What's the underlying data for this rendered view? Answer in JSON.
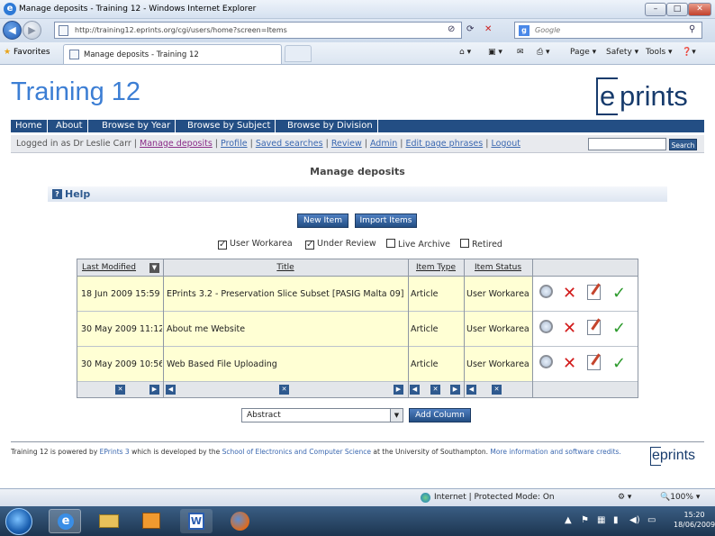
{
  "window": {
    "title": "Manage deposits - Training 12 - Windows Internet Explorer",
    "minimize": "–",
    "maximize": "□",
    "close": "✕"
  },
  "addressbar": {
    "url": "http://training12.eprints.org/cgi/users/home?screen=Items",
    "search_placeholder": "Google"
  },
  "favorites": {
    "label": "Favorites",
    "tab_title": "Manage deposits - Training 12",
    "commands": [
      "Page ▾",
      "Safety ▾",
      "Tools ▾"
    ]
  },
  "site": {
    "title": "Training 12",
    "logo_e": "e",
    "logo_rest": "prints"
  },
  "menu": [
    "Home",
    "About",
    "Browse by Year",
    "Browse by Subject",
    "Browse by Division"
  ],
  "userbar": {
    "logged_in": "Logged in as Dr Leslie Carr |",
    "links": [
      "Manage deposits",
      "Profile",
      "Saved searches",
      "Review",
      "Admin",
      "Edit page phrases",
      "Logout"
    ],
    "search_button": "Search"
  },
  "page": {
    "heading": "Manage deposits",
    "help": "Help",
    "new_item": "New Item",
    "import_items": "Import Items"
  },
  "filters": [
    {
      "label": "User Workarea",
      "checked": true
    },
    {
      "label": "Under Review",
      "checked": true
    },
    {
      "label": "Live Archive",
      "checked": false
    },
    {
      "label": "Retired",
      "checked": false
    }
  ],
  "table": {
    "columns": [
      "Last Modified",
      "Title",
      "Item Type",
      "Item Status"
    ],
    "rows": [
      {
        "modified": "18 Jun 2009 15:59",
        "title": "EPrints 3.2 - Preservation Slice Subset [PASIG Malta 09]",
        "type": "Article",
        "status": "User Workarea"
      },
      {
        "modified": "30 May 2009 11:12",
        "title": "About me Website",
        "type": "Article",
        "status": "User Workarea"
      },
      {
        "modified": "30 May 2009 10:56",
        "title": "Web Based File Uploading",
        "type": "Article",
        "status": "User Workarea"
      }
    ]
  },
  "add_column": {
    "selected": "Abstract",
    "button": "Add Column"
  },
  "footer": {
    "text1": "Training 12 is powered by ",
    "eprints_link": "EPrints 3",
    "text2": " which is developed by the ",
    "school_link": "School of Electronics and Computer Science",
    "text3": " at the University of Southampton. ",
    "more_link": "More information and software credits."
  },
  "statusbar": {
    "zone": "Internet | Protected Mode: On",
    "zoom": "100%"
  },
  "clock": {
    "time": "15:20",
    "date": "18/06/2009"
  }
}
